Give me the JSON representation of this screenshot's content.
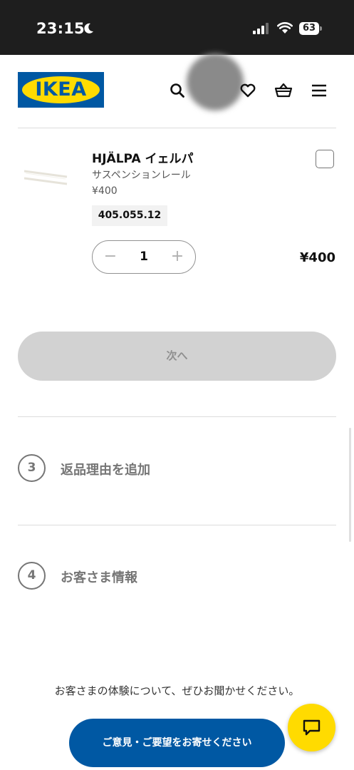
{
  "status_bar": {
    "time": "23:15",
    "battery": "63",
    "icons": [
      "moon-icon",
      "signal-icon",
      "wifi-icon",
      "battery-icon"
    ]
  },
  "header": {
    "logo_text": "IKEA",
    "icons": [
      "search-icon",
      "heart-icon",
      "basket-icon",
      "menu-icon"
    ]
  },
  "product": {
    "name": "HJÄLPA イェルパ",
    "description": "サスペンションレール",
    "unit_price": "¥400",
    "article_number": "405.055.12",
    "quantity": "1",
    "line_total": "¥400",
    "minus_symbol": "−",
    "plus_symbol": "+"
  },
  "actions": {
    "next_label": "次へ"
  },
  "steps": [
    {
      "number": "3",
      "title": "返品理由を追加"
    },
    {
      "number": "4",
      "title": "お客さま情報"
    }
  ],
  "feedback": {
    "prompt": "お客さまの体験について、ぜひお聞かせください。",
    "button_label": "ご意見・ご要望をお寄せください"
  },
  "colors": {
    "ikea_blue": "#0058a3",
    "ikea_yellow": "#ffdb00",
    "disabled_gray": "#d2d2d2",
    "status_bar": "#1e1e1e"
  }
}
